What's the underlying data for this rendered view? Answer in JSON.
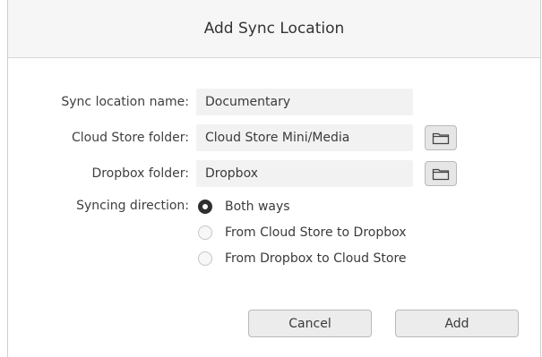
{
  "dialog": {
    "title": "Add Sync Location"
  },
  "form": {
    "sync_name": {
      "label": "Sync location name:",
      "value": "Documentary"
    },
    "cloud_folder": {
      "label": "Cloud Store folder:",
      "value": "Cloud Store Mini/Media"
    },
    "dropbox_folder": {
      "label": "Dropbox folder:",
      "value": "Dropbox"
    },
    "direction": {
      "label": "Syncing direction:",
      "options": [
        {
          "label": "Both ways",
          "selected": true
        },
        {
          "label": "From Cloud Store to Dropbox",
          "selected": false
        },
        {
          "label": "From Dropbox to Cloud Store",
          "selected": false
        }
      ]
    }
  },
  "buttons": {
    "cancel": "Cancel",
    "add": "Add"
  },
  "icons": {
    "folder": "folder-icon"
  }
}
